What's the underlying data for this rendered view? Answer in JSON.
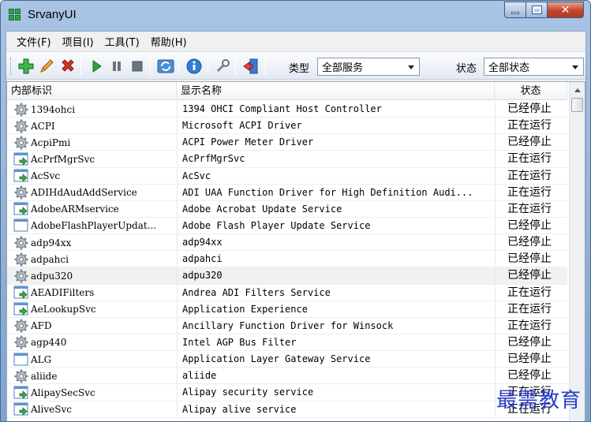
{
  "window": {
    "title": "SrvanyUI"
  },
  "menu": [
    "文件(F)",
    "项目(I)",
    "工具(T)",
    "帮助(H)"
  ],
  "toolbar": {
    "type_label": "类型",
    "type_value": "全部服务",
    "status_label": "状态",
    "status_value": "全部状态"
  },
  "columns": {
    "id": "内部标识",
    "name": "显示名称",
    "status": "状态"
  },
  "rows": [
    {
      "id": "1394ohci",
      "name": "1394 OHCI Compliant Host Controller",
      "status": "已经停止",
      "icon": "gear-icon"
    },
    {
      "id": "ACPI",
      "name": "Microsoft ACPI Driver",
      "status": "正在运行",
      "icon": "gear-icon"
    },
    {
      "id": "AcpiPmi",
      "name": "ACPI Power Meter Driver",
      "status": "已经停止",
      "icon": "gear-icon"
    },
    {
      "id": "AcPrfMgrSvc",
      "name": "AcPrfMgrSvc",
      "status": "正在运行",
      "icon": "service-window-icon"
    },
    {
      "id": "AcSvc",
      "name": "AcSvc",
      "status": "正在运行",
      "icon": "service-window-icon"
    },
    {
      "id": "ADIHdAudAddService",
      "name": "ADI UAA Function Driver for High Definition Audi...",
      "status": "正在运行",
      "icon": "gear-icon"
    },
    {
      "id": "AdobeARMservice",
      "name": "Adobe Acrobat Update Service",
      "status": "正在运行",
      "icon": "service-window-icon"
    },
    {
      "id": "AdobeFlashPlayerUpdat...",
      "name": "Adobe Flash Player Update Service",
      "status": "已经停止",
      "icon": "blank-window-icon"
    },
    {
      "id": "adp94xx",
      "name": "adp94xx",
      "status": "已经停止",
      "icon": "gear-icon"
    },
    {
      "id": "adpahci",
      "name": "adpahci",
      "status": "已经停止",
      "icon": "gear-icon"
    },
    {
      "id": "adpu320",
      "name": "adpu320",
      "status": "已经停止",
      "icon": "gear-icon"
    },
    {
      "id": "AEADIFilters",
      "name": "Andrea ADI Filters Service",
      "status": "正在运行",
      "icon": "service-window-icon"
    },
    {
      "id": "AeLookupSvc",
      "name": "Application Experience",
      "status": "正在运行",
      "icon": "service-window-icon"
    },
    {
      "id": "AFD",
      "name": "Ancillary Function Driver for Winsock",
      "status": "正在运行",
      "icon": "gear-icon"
    },
    {
      "id": "agp440",
      "name": "Intel AGP Bus Filter",
      "status": "已经停止",
      "icon": "gear-icon"
    },
    {
      "id": "ALG",
      "name": "Application Layer Gateway Service",
      "status": "已经停止",
      "icon": "blank-window-icon"
    },
    {
      "id": "aliide",
      "name": "aliide",
      "status": "已经停止",
      "icon": "gear-icon"
    },
    {
      "id": "AlipaySecSvc",
      "name": "Alipay security service",
      "status": "正在运行",
      "icon": "service-window-icon"
    },
    {
      "id": "AliveSvc",
      "name": "Alipay alive service",
      "status": "正在运行",
      "icon": "service-window-icon"
    }
  ],
  "watermark": "最需教育"
}
